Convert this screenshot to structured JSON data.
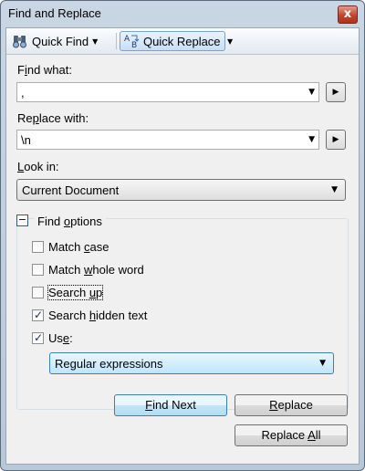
{
  "window": {
    "title": "Find and Replace",
    "close_glyph": "x"
  },
  "toolbar": {
    "quick_find": {
      "label": "Quick Find",
      "icon": "binoculars-icon"
    },
    "quick_replace": {
      "label": "Quick Replace",
      "icon": "replace-icon"
    }
  },
  "find_what": {
    "label_pre": "F",
    "label_mn": "i",
    "label_post": "nd what:",
    "value": ","
  },
  "replace_with": {
    "label_pre": "Re",
    "label_mn": "p",
    "label_post": "lace with:",
    "value": "\\n"
  },
  "look_in": {
    "label_pre": "",
    "label_mn": "L",
    "label_post": "ook in:",
    "value": "Current Document"
  },
  "find_options": {
    "label_pre": "Find ",
    "label_mn": "o",
    "label_post": "ptions",
    "match_case": {
      "pre": "Match ",
      "mn": "c",
      "post": "ase",
      "checked": false
    },
    "match_whole_word": {
      "pre": "Match ",
      "mn": "w",
      "post": "hole word",
      "checked": false
    },
    "search_up": {
      "pre": "Search ",
      "mn": "u",
      "post": "p",
      "checked": false
    },
    "search_hidden": {
      "pre": "Search ",
      "mn": "h",
      "post": "idden text",
      "checked": true
    },
    "use": {
      "pre": "Us",
      "mn": "e",
      "post": ":",
      "checked": true,
      "value": "Regular expressions"
    }
  },
  "buttons": {
    "find_next": {
      "pre": "",
      "mn": "F",
      "post": "ind Next"
    },
    "replace": {
      "pre": "",
      "mn": "R",
      "post": "eplace"
    },
    "replace_all": {
      "pre": "Replace ",
      "mn": "A",
      "post": "ll"
    }
  },
  "colors": {
    "accent": "#3c7fb1",
    "title_bar": "#c9d6e3",
    "close": "#c2452f"
  }
}
